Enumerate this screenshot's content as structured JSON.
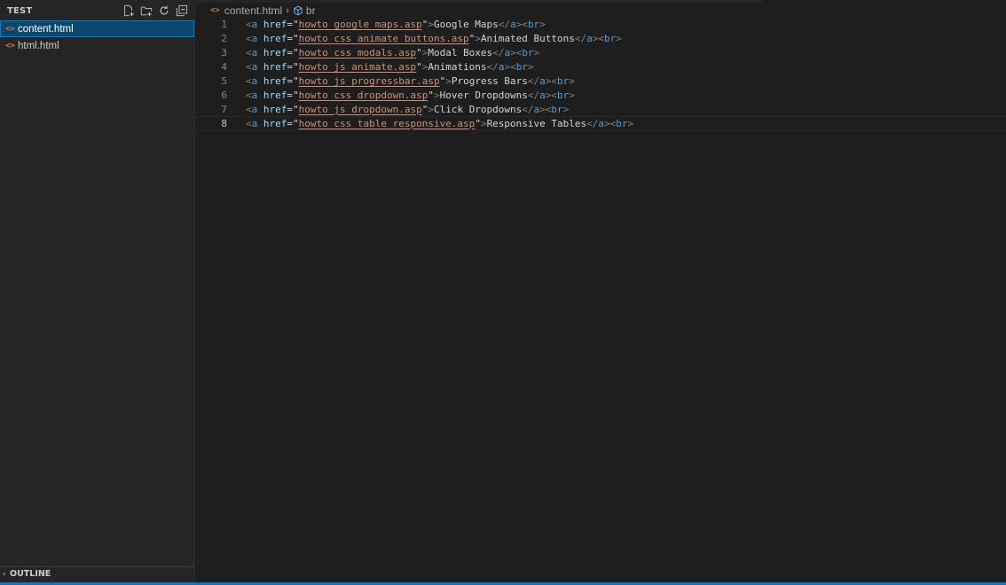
{
  "explorer": {
    "title": "TEST",
    "files": [
      {
        "icon": "<>",
        "name": "content.html",
        "active": true
      },
      {
        "icon": "<>",
        "name": "html.html",
        "active": false
      }
    ],
    "outline_label": "OUTLINE"
  },
  "breadcrumb": {
    "file_icon": "<>",
    "file": "content.html",
    "symbol": "br"
  },
  "editor": {
    "lines": [
      {
        "num": "1",
        "href": "howto_google_maps.asp",
        "text": "Google Maps"
      },
      {
        "num": "2",
        "href": "howto_css_animate_buttons.asp",
        "text": "Animated Buttons"
      },
      {
        "num": "3",
        "href": "howto_css_modals.asp",
        "text": "Modal Boxes"
      },
      {
        "num": "4",
        "href": "howto_js_animate.asp",
        "text": "Animations"
      },
      {
        "num": "5",
        "href": "howto_js_progressbar.asp",
        "text": "Progress Bars"
      },
      {
        "num": "6",
        "href": "howto_css_dropdown.asp",
        "text": "Hover Dropdowns"
      },
      {
        "num": "7",
        "href": "howto_js_dropdown.asp",
        "text": "Click Dropdowns"
      },
      {
        "num": "8",
        "href": "howto_css_table_responsive.asp",
        "text": "Responsive Tables"
      }
    ],
    "current_line": 8,
    "tokens": {
      "open": "<",
      "tag_a": "a",
      "attr": "href",
      "eq": "=",
      "quote": "\"",
      "close": ">",
      "end_open": "</",
      "tag_br": "br"
    }
  },
  "colors": {
    "accent": "#007acc",
    "selection": "#094771",
    "html_icon": "#e37933"
  }
}
